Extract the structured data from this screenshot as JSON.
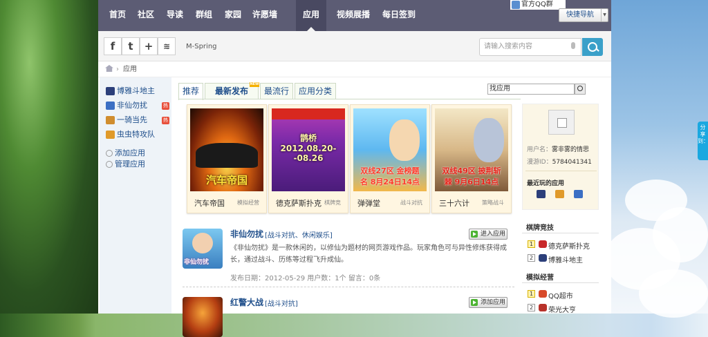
{
  "nav": {
    "items": [
      "首页",
      "社区",
      "导读",
      "群组",
      "家园",
      "许愿墙",
      "应用",
      "视频展播",
      "每日签到"
    ],
    "active": "应用",
    "qq_group": "官方QQ群",
    "quick_nav": "快捷导航",
    "colors": {
      "nav_bg": "#5c5c74",
      "accent": "#3aa0c9"
    }
  },
  "toolbar": {
    "social": [
      "f",
      "t",
      "+",
      "rss"
    ],
    "username": "M-Spring",
    "search_placeholder": "请输入搜索内容"
  },
  "breadcrumb": {
    "current": "应用"
  },
  "sidebar": {
    "apps": [
      {
        "label": "博雅斗地主",
        "hot": false
      },
      {
        "label": "非仙勿扰",
        "hot": true
      },
      {
        "label": "一骑当先",
        "hot": true
      },
      {
        "label": "虫虫特攻队",
        "hot": false
      }
    ],
    "hot_label": "热",
    "add_app": "添加应用",
    "manage_app": "管理应用"
  },
  "tabs": [
    {
      "label": "推荐",
      "active": true
    },
    {
      "label": "最新发布",
      "badge": "NEW"
    },
    {
      "label": "最流行"
    },
    {
      "label": "应用分类"
    }
  ],
  "find_app": {
    "value": "找应用"
  },
  "featured": [
    {
      "name": "汽车帝国",
      "category": "模拟经营",
      "poster": "汽车帝国"
    },
    {
      "name": "德克萨斯扑克",
      "category": "棋牌竞",
      "poster": "鹊桥 2012.08.20--08.26"
    },
    {
      "name": "弹弹堂",
      "category": "战斗对抗",
      "poster": "双线27区 金榜题名 8月24日14点"
    },
    {
      "name": "三十六计",
      "category": "策略战斗",
      "poster": "双线49区 披荆斩棘 9月6日14点"
    }
  ],
  "list": [
    {
      "title": "非仙勿扰",
      "category": "[战斗对抗、休闲娱乐]",
      "desc": "《非仙勿扰》是一款休闲的，以修仙为题材的网页游戏作品。玩家角色可与异性修炼获得成长，通过战斗、历练等过程飞升成仙。",
      "meta": "发布日期：2012-05-29 用户数：1个  留言：0条",
      "button": "进入应用",
      "thumb_text": "非仙勿扰"
    },
    {
      "title": "红警大战",
      "category": "[战斗对抗]",
      "button": "添加应用"
    }
  ],
  "profile": {
    "user_label": "用户名：",
    "user_value": "雾非雾的情思",
    "id_label": "漫游ID：",
    "id_value": "5784041341",
    "recent_title": "最近玩的应用"
  },
  "rankings": [
    {
      "title": "棋牌竞技",
      "items": [
        {
          "rank": "1",
          "name": "德克萨斯扑克"
        },
        {
          "rank": "2",
          "name": "博雅斗地主"
        }
      ]
    },
    {
      "title": "模拟经营",
      "items": [
        {
          "rank": "1",
          "name": "QQ超市"
        },
        {
          "rank": "2",
          "name": "荣光大亨"
        }
      ]
    }
  ],
  "share": "分享到："
}
